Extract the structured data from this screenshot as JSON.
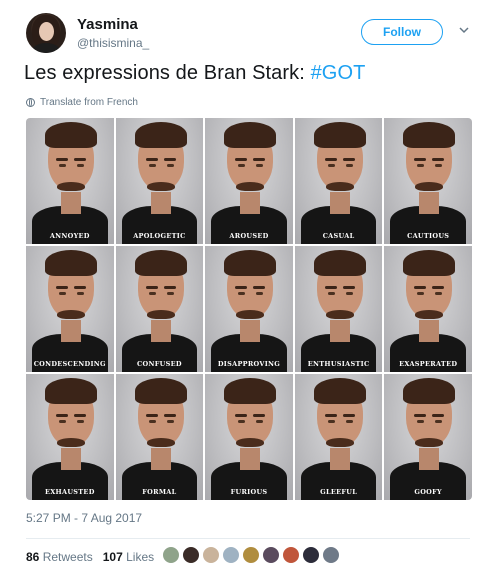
{
  "user": {
    "name": "Yasmina",
    "handle": "@thisismina_",
    "follow_label": "Follow"
  },
  "tweet": {
    "text": "Les expressions de Bran Stark: ",
    "hashtag": "#GOT",
    "translate_label": "Translate from French",
    "photo_labels": [
      "ANNOYED",
      "APOLOGETIC",
      "AROUSED",
      "CASUAL",
      "CAUTIOUS",
      "CONDESCENDING",
      "CONFUSED",
      "DISAPPROVING",
      "ENTHUSIASTIC",
      "EXASPERATED",
      "EXHAUSTED",
      "FORMAL",
      "FURIOUS",
      "GLEEFUL",
      "GOOFY"
    ],
    "timestamp": "5:27 PM - 7 Aug 2017"
  },
  "stats": {
    "retweets_count": "86",
    "retweets_label": "Retweets",
    "likes_count": "107",
    "likes_label": "Likes"
  },
  "liker_colors": [
    "#8fa38a",
    "#3a2b27",
    "#c9b39b",
    "#9fb2c2",
    "#b08d3e",
    "#5a4b5e",
    "#c0563b",
    "#2c2c3a",
    "#6f7a88"
  ],
  "colors": {
    "accent": "#1da1f2",
    "muted": "#657786",
    "text": "#14171a"
  }
}
